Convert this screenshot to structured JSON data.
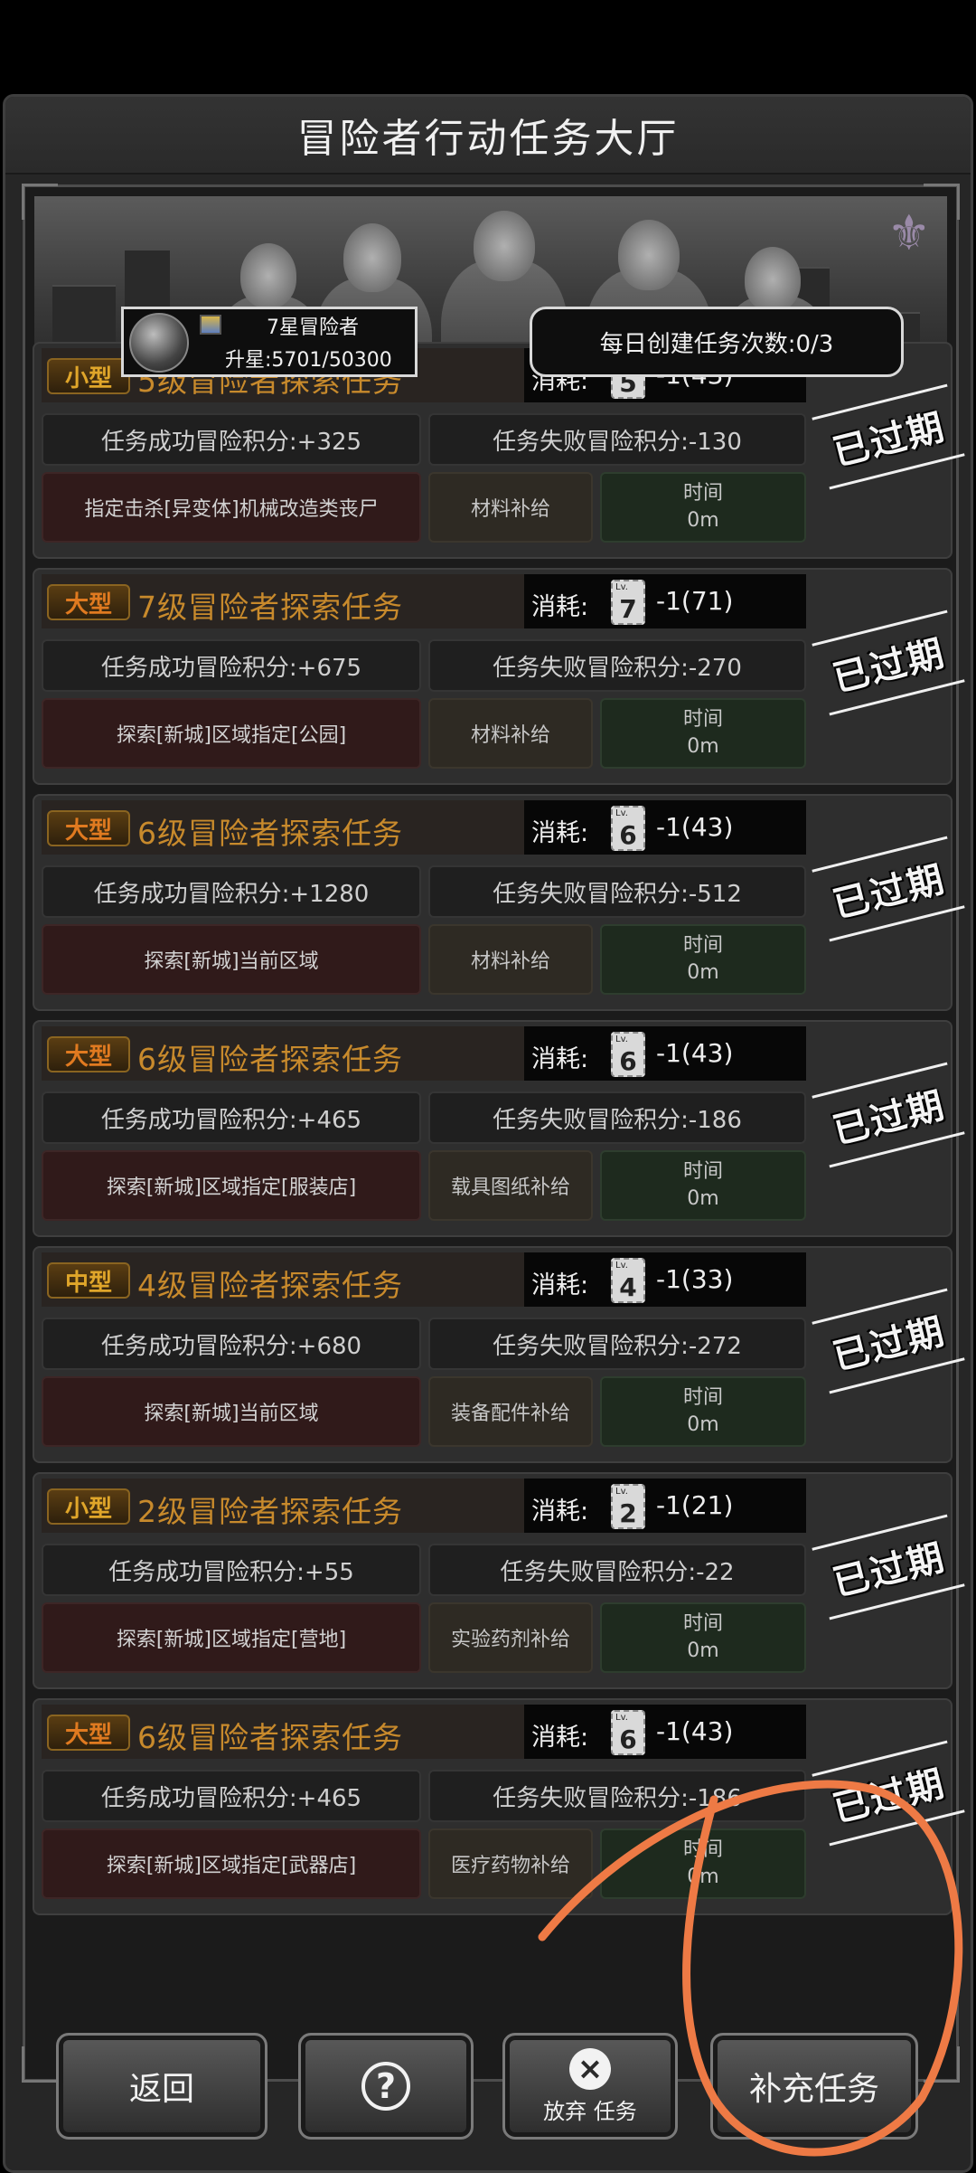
{
  "title": "冒险者行动任务大厅",
  "player": {
    "rank_label": "7星冒险者",
    "rank_progress": "升星:5701/50300"
  },
  "daily_limit": "每日创建任务次数:0/3",
  "labels": {
    "cost": "消耗:",
    "time": "时间",
    "expired": "已过期"
  },
  "tasks": [
    {
      "size": "小型",
      "size_color": "#e0a62a",
      "name": "5级冒险者探索任务",
      "level": "5",
      "cost": "-1(43)",
      "success": "任务成功冒险积分:+325",
      "fail": "任务失败冒险积分:-130",
      "target": "指定击杀[异变体]机械改造类丧尸",
      "reward": "材料补给",
      "time": "0m"
    },
    {
      "size": "大型",
      "size_color": "#e07a20",
      "name": "7级冒险者探索任务",
      "level": "7",
      "cost": "-1(71)",
      "success": "任务成功冒险积分:+675",
      "fail": "任务失败冒险积分:-270",
      "target": "探索[新城]区域指定[公园]",
      "reward": "材料补给",
      "time": "0m"
    },
    {
      "size": "大型",
      "size_color": "#e07a20",
      "name": "6级冒险者探索任务",
      "level": "6",
      "cost": "-1(43)",
      "success": "任务成功冒险积分:+1280",
      "fail": "任务失败冒险积分:-512",
      "target": "探索[新城]当前区域",
      "reward": "材料补给",
      "time": "0m"
    },
    {
      "size": "大型",
      "size_color": "#e07a20",
      "name": "6级冒险者探索任务",
      "level": "6",
      "cost": "-1(43)",
      "success": "任务成功冒险积分:+465",
      "fail": "任务失败冒险积分:-186",
      "target": "探索[新城]区域指定[服装店]",
      "reward": "载具图纸补给",
      "time": "0m"
    },
    {
      "size": "中型",
      "size_color": "#e0a62a",
      "name": "4级冒险者探索任务",
      "level": "4",
      "cost": "-1(33)",
      "success": "任务成功冒险积分:+680",
      "fail": "任务失败冒险积分:-272",
      "target": "探索[新城]当前区域",
      "reward": "装备配件补给",
      "time": "0m"
    },
    {
      "size": "小型",
      "size_color": "#e0a62a",
      "name": "2级冒险者探索任务",
      "level": "2",
      "cost": "-1(21)",
      "success": "任务成功冒险积分:+55",
      "fail": "任务失败冒险积分:-22",
      "target": "探索[新城]区域指定[营地]",
      "reward": "实验药剂补给",
      "time": "0m"
    },
    {
      "size": "大型",
      "size_color": "#e07a20",
      "name": "6级冒险者探索任务",
      "level": "6",
      "cost": "-1(43)",
      "success": "任务成功冒险积分:+465",
      "fail": "任务失败冒险积分:-186",
      "target": "探索[新城]区域指定[武器店]",
      "reward": "医疗药物补给",
      "time": "0m"
    }
  ],
  "buttons": {
    "back": "返回",
    "abandon": "放弃 任务",
    "refill": "补充任务"
  },
  "icons": {
    "help": "help-question-icon",
    "abandon": "close-circle-icon",
    "emblem": "faction-emblem-icon"
  },
  "colors": {
    "task_name": "#c88a2c",
    "annotation_stroke": "#ee7a45"
  }
}
